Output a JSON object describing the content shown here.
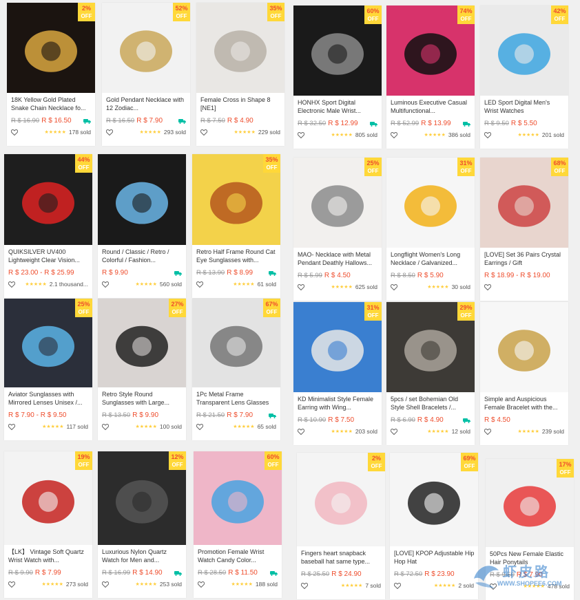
{
  "colors": {
    "accent": "#ee4d2d",
    "badge": "#ffd839",
    "star": "#ffce3d",
    "shipping": "#00bfa5"
  },
  "badge_off": "OFF",
  "products": [
    {
      "name": "18K Yellow Gold Plated Snake Chain Necklace fo...",
      "old": "R $ 16.90",
      "price": "R $ 16.50",
      "discount": "2%",
      "sold": "178 sold",
      "free_ship": true,
      "icon": "gold-chain-image"
    },
    {
      "name": "Gold Pendant Necklace with 12 Zodiac...",
      "old": "R $ 16.50",
      "price": "R $ 7.90",
      "discount": "52%",
      "sold": "293 sold",
      "free_ship": true,
      "icon": "zodiac-necklace-image"
    },
    {
      "name": "Female Cross in Shape 8 [NE1]",
      "old": "R $ 7.50",
      "price": "R $ 4.90",
      "discount": "35%",
      "sold": "229 sold",
      "free_ship": false,
      "icon": "cross-necklace-image"
    },
    {
      "name": "HONHX Sport Digital Electronic Male Wrist...",
      "old": "R $ 32.50",
      "price": "R $ 12.99",
      "discount": "60%",
      "sold": "805 sold",
      "free_ship": true,
      "icon": "digital-watch-image"
    },
    {
      "name": "Luminous Executive Casual Multifunctional...",
      "old": "R $ 52.99",
      "price": "R $ 13.99",
      "discount": "74%",
      "sold": "386 sold",
      "free_ship": true,
      "icon": "executive-watch-image"
    },
    {
      "name": "LED Sport Digital Men's Wrist Watches",
      "old": "R $ 9.50",
      "price": "R $ 5.50",
      "discount": "42%",
      "sold": "201 sold",
      "free_ship": false,
      "icon": "led-watch-image"
    },
    {
      "name": "QUIKSILVER UV400 Lightweight Clear Vision...",
      "old": "",
      "price": "R $ 23.00 - R $ 25.99",
      "discount": "44%",
      "sold": "2.1 thousand...",
      "free_ship": false,
      "icon": "sunglasses-box-image"
    },
    {
      "name": "Round / Classic / Retro / Colorful / Fashion...",
      "old": "",
      "price": "R $ 9.90",
      "discount": "",
      "sold": "560 sold",
      "free_ship": true,
      "icon": "round-sunglasses-image"
    },
    {
      "name": "Retro Half Frame Round Cat Eye Sunglasses with...",
      "old": "R $ 13.90",
      "price": "R $ 8.99",
      "discount": "35%",
      "sold": "61 sold",
      "free_ship": true,
      "icon": "cat-eye-sunglasses-image"
    },
    {
      "name": "MAO- Necklace with Metal Pendant Deathly Hallows...",
      "old": "R $ 5.99",
      "price": "R $ 4.50",
      "discount": "25%",
      "sold": "625 sold",
      "free_ship": false,
      "icon": "triangle-necklace-image"
    },
    {
      "name": "Longflight Women's Long Necklace / Galvanized...",
      "old": "R $ 8.50",
      "price": "R $ 5.90",
      "discount": "31%",
      "sold": "30 sold",
      "free_ship": false,
      "icon": "sunflower-necklace-image"
    },
    {
      "name": "[LOVE] Set 36 Pairs Crystal Earrings / Gift",
      "old": "",
      "price": "R $ 18.99 - R $ 19.00",
      "discount": "68%",
      "sold": "",
      "free_ship": false,
      "icon": "earrings-set-image"
    },
    {
      "name": "Aviator Sunglasses with Mirrored Lenses Unisex /...",
      "old": "",
      "price": "R $ 7.90 - R $ 9.50",
      "discount": "25%",
      "sold": "117 sold",
      "free_ship": false,
      "icon": "aviator-sunglasses-image"
    },
    {
      "name": "Retro Style Round Sunglasses with Large...",
      "old": "R $ 13.50",
      "price": "R $ 9.90",
      "discount": "27%",
      "sold": "100 sold",
      "free_ship": false,
      "icon": "large-sunglasses-image"
    },
    {
      "name": "1Pc Metal Frame Transparent Lens Glasses",
      "old": "R $ 21.50",
      "price": "R $ 7.90",
      "discount": "67%",
      "sold": "65 sold",
      "free_ship": true,
      "icon": "metal-glasses-image"
    },
    {
      "name": "KD Minimalist Style Female Earring with Wing...",
      "old": "R $ 10.90",
      "price": "R $ 7.50",
      "discount": "31%",
      "sold": "203 sold",
      "free_ship": false,
      "icon": "wing-earrings-image"
    },
    {
      "name": "5pcs / set Bohemian Old Style Shell Bracelets /...",
      "old": "R $ 6.90",
      "price": "R $ 4.90",
      "discount": "29%",
      "sold": "12 sold",
      "free_ship": true,
      "icon": "shell-bracelets-image"
    },
    {
      "name": "Simple and Auspicious Female Bracelet with the...",
      "old": "",
      "price": "R $ 4.50",
      "discount": "",
      "sold": "239 sold",
      "free_ship": false,
      "icon": "gold-bracelet-image"
    },
    {
      "name": "【LK】 Vintage Soft Quartz Wrist Watch with...",
      "old": "R $ 9.90",
      "price": "R $ 7.99",
      "discount": "19%",
      "sold": "273 sold",
      "free_ship": false,
      "icon": "red-watch-image"
    },
    {
      "name": "Luxurious Nylon Quartz Watch for Men and...",
      "old": "R $ 16.99",
      "price": "R $ 14.90",
      "discount": "12%",
      "sold": "253 sold",
      "free_ship": true,
      "icon": "nylon-watch-image"
    },
    {
      "name": "Promotion Female Wrist Watch Candy Color...",
      "old": "R $ 28.50",
      "price": "R $ 11.50",
      "discount": "60%",
      "sold": "188 sold",
      "free_ship": true,
      "icon": "candy-watch-image"
    },
    {
      "name": "Fingers heart snapback baseball hat same type...",
      "old": "R $ 25.50",
      "price": "R $ 24.90",
      "discount": "2%",
      "sold": "7 sold",
      "free_ship": false,
      "icon": "pink-cap-image"
    },
    {
      "name": "[LOVE] KPOP Adjustable Hip Hop Hat",
      "old": "R $ 72.50",
      "price": "R $ 23.90",
      "discount": "69%",
      "sold": "2 sold",
      "free_ship": false,
      "icon": "kpop-hats-image"
    },
    {
      "name": "50Pcs New Female Elastic Hair Ponytails",
      "old": "R $ 9.50",
      "price": "R $ 7.90",
      "discount": "17%",
      "sold": "478 sold",
      "free_ship": false,
      "icon": "hair-ties-image"
    }
  ],
  "watermark": {
    "title": "虾皮路",
    "url": "WWW.SHOPEE6.COM"
  }
}
